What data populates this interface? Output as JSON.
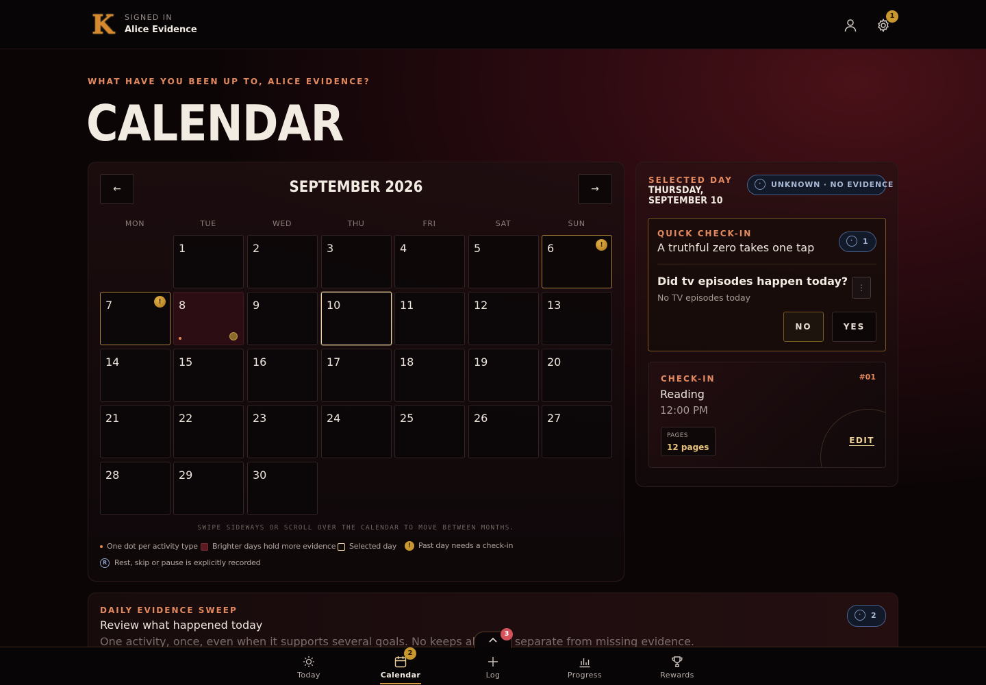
{
  "header": {
    "logo_letter": "K",
    "signed_in_label": "SIGNED IN",
    "user_name": "Alice Evidence",
    "settings_badge": "1"
  },
  "page": {
    "eyebrow": "WHAT HAVE YOU BEEN UP TO, ALICE EVIDENCE?",
    "title": "CALENDAR"
  },
  "calendar": {
    "prev_label": "←",
    "next_label": "→",
    "month_title": "SEPTEMBER 2026",
    "weekdays": [
      "MON",
      "TUE",
      "WED",
      "THU",
      "FRI",
      "SAT",
      "SUN"
    ],
    "days": [
      "1",
      "2",
      "3",
      "4",
      "5",
      "6",
      "7",
      "8",
      "9",
      "10",
      "11",
      "12",
      "13",
      "14",
      "15",
      "16",
      "17",
      "18",
      "19",
      "20",
      "21",
      "22",
      "23",
      "24",
      "25",
      "26",
      "27",
      "28",
      "29",
      "30"
    ],
    "flag_glyph": "!",
    "hint": "SWIPE SIDEWAYS OR SCROLL OVER THE CALENDAR TO MOVE BETWEEN MONTHS.",
    "legend": {
      "dot": "One dot per activity type",
      "brighter": "Brighter days hold more evidence",
      "selected": "Selected day",
      "needs_checkin": "Past day needs a check-in",
      "rest": "Rest, skip or pause is explicitly recorded",
      "rest_glyph": "R"
    }
  },
  "selected_day": {
    "label": "SELECTED DAY",
    "date_line1": "THURSDAY,",
    "date_line2": "SEPTEMBER 10",
    "status_pill": "UNKNOWN · NO EVIDENCE",
    "status_icon_glyph": "·",
    "quick_checkin": {
      "eyebrow": "QUICK CHECK-IN",
      "title": "A truthful zero takes one tap",
      "count": "1",
      "question": "Did tv episodes happen today?",
      "subtitle": "No TV episodes today",
      "more_glyph": "⋮",
      "no_label": "NO",
      "yes_label": "YES"
    },
    "checkin": {
      "eyebrow": "CHECK-IN",
      "number": "#01",
      "title": "Reading",
      "time": "12:00 PM",
      "stat_label": "PAGES",
      "stat_value": "12 pages",
      "edit_label": "EDIT"
    }
  },
  "sweep": {
    "eyebrow": "DAILY EVIDENCE SWEEP",
    "title": "Review what happened today",
    "description": "One activity, once, even when it supports several goals. No keeps absence separate from missing evidence.",
    "count": "2"
  },
  "collapse_badge": "3",
  "bottom_nav": {
    "today": "Today",
    "calendar": "Calendar",
    "calendar_badge": "2",
    "log": "Log",
    "progress": "Progress",
    "rewards": "Rewards"
  },
  "colors": {
    "accent_orange": "#e3895f",
    "gold": "#c8972f",
    "background": "#0a0607",
    "status_blue": "#49618a"
  }
}
